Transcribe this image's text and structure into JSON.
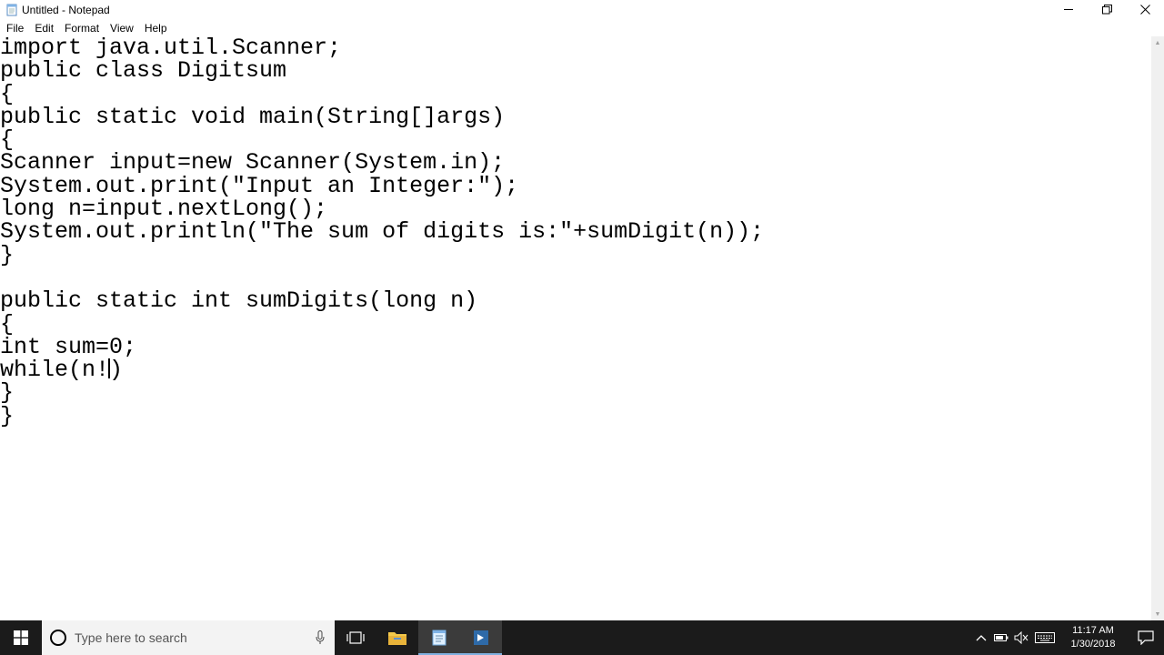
{
  "window": {
    "title": "Untitled - Notepad",
    "controls": {
      "minimize": "—",
      "restore": "❐",
      "close": "✕"
    }
  },
  "menu": {
    "items": [
      "File",
      "Edit",
      "Format",
      "View",
      "Help"
    ]
  },
  "editor": {
    "lines": [
      "import java.util.Scanner;",
      "public class Digitsum",
      "{",
      "public static void main(String[]args)",
      "{",
      "Scanner input=new Scanner(System.in);",
      "System.out.print(\"Input an Integer:\");",
      "long n=input.nextLong();",
      "System.out.println(\"The sum of digits is:\"+sumDigit(n));",
      "}",
      "",
      "public static int sumDigits(long n)",
      "{",
      "int sum=0;",
      "while(n!",
      "}",
      "}"
    ],
    "caret_line_suffix": ")"
  },
  "taskbar": {
    "search_placeholder": "Type here to search",
    "clock_time": "11:17 AM",
    "clock_date": "1/30/2018"
  },
  "icons": {
    "app": "notepad-icon",
    "start": "windows-logo-icon",
    "search": "cortana-circle-icon",
    "mic": "microphone-icon",
    "task_view": "task-view-icon",
    "explorer": "file-explorer-icon",
    "notepad": "notepad-icon",
    "editor_app": "editor-app-icon",
    "tray_up": "chevron-up-icon",
    "battery": "battery-icon",
    "volume": "volume-icon",
    "keyboard": "keyboard-icon",
    "notifications": "action-center-icon"
  }
}
